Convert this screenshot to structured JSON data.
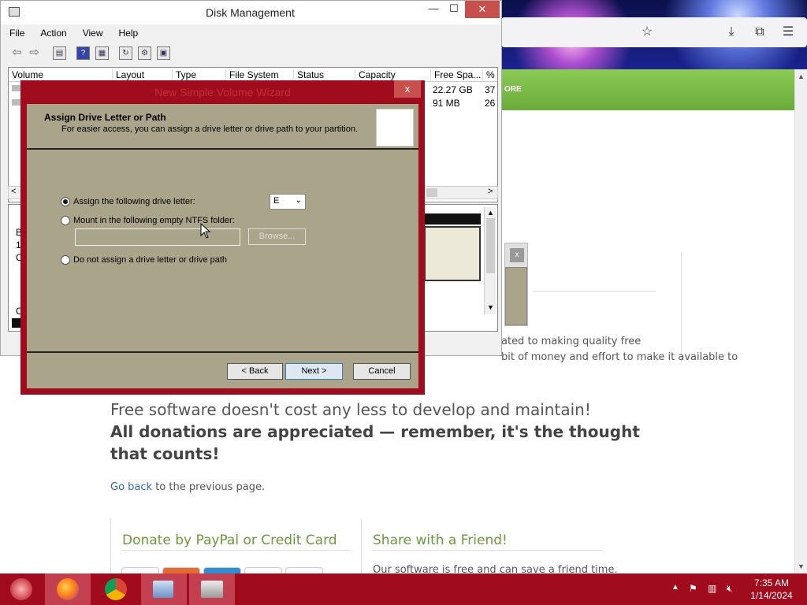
{
  "browser": {
    "banner_text": "ORE",
    "paragraph_line1": "ated to making quality free",
    "paragraph_line2": "bit of money and effort to make it available to",
    "big_line": "Free software doesn't cost any less to develop and maintain!",
    "bold_line": "All donations are appreciated — remember, it's the thought that counts!",
    "go_back_link": "Go back",
    "go_back_rest": " to the previous page.",
    "section_donate": "Donate by PayPal or Credit Card",
    "section_share": "Share with a Friend!",
    "share_text": "Our software is free and can save a friend time.",
    "popup_close": "x"
  },
  "disk_management": {
    "title": "Disk Management",
    "menu": [
      "File",
      "Action",
      "View",
      "Help"
    ],
    "columns": [
      "Volume",
      "Layout",
      "Type",
      "File System",
      "Status",
      "Capacity",
      "Free Spa...",
      "% F"
    ],
    "rows": [
      {
        "free": "22.27 GB",
        "pct": "37"
      },
      {
        "free": "91 MB",
        "pct": "26"
      }
    ],
    "lower_fragments": [
      "B",
      "1",
      "C",
      "C"
    ]
  },
  "wizard": {
    "title": "New Simple Volume Wizard",
    "header_title": "Assign Drive Letter or Path",
    "header_subtitle": "For easier access, you can assign a drive letter or drive path to your partition.",
    "option_assign": "Assign the following drive letter:",
    "option_mount": "Mount in the following empty NTFS folder:",
    "option_none": "Do not assign a drive letter or drive path",
    "drive_letter": "E",
    "folder_value": "",
    "browse_label": "Browse...",
    "back_label": "< Back",
    "next_label": "Next >",
    "cancel_label": "Cancel",
    "close_label": "x"
  },
  "taskbar": {
    "time": "7:35 AM",
    "date": "1/14/2024"
  },
  "colors": {
    "accent_red": "#a10b1e",
    "dialog_body": "#aaa58a",
    "link_blue": "#2d6ab4",
    "section_green": "#6a9a3a"
  }
}
